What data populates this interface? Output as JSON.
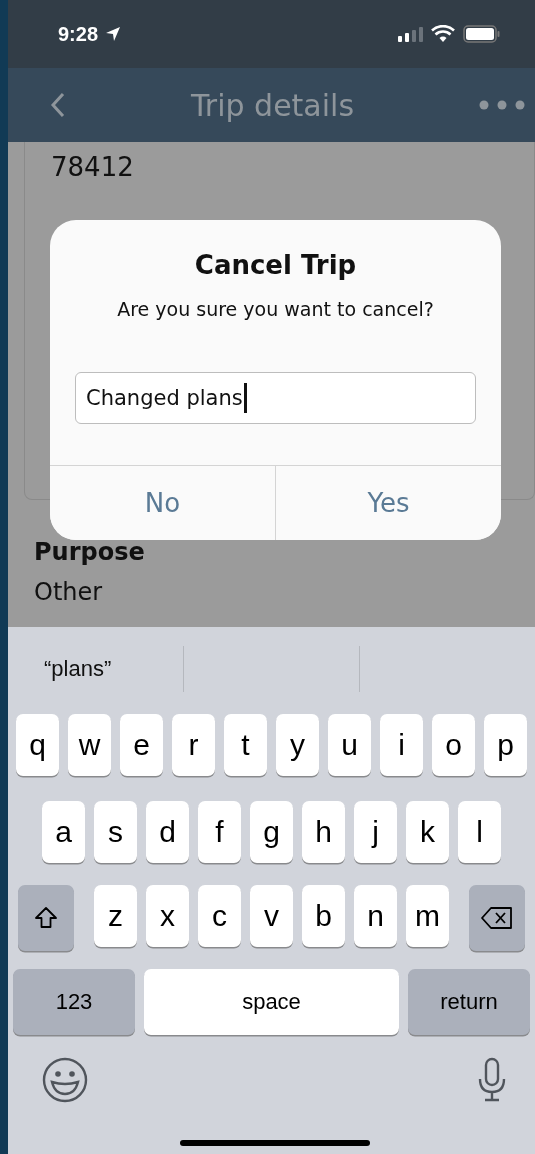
{
  "status_bar": {
    "time": "9:28"
  },
  "nav_bar": {
    "title": "Trip details"
  },
  "background": {
    "address_tail": "78412",
    "purpose_label": "Purpose",
    "purpose_value": "Other"
  },
  "dialog": {
    "title": "Cancel Trip",
    "message": "Are you sure you want to cancel?",
    "field": {
      "value": "Changed plans",
      "focused": true
    },
    "buttons": [
      "No",
      "Yes"
    ]
  },
  "keyboard": {
    "suggestions": [
      "“plans”"
    ],
    "rows": [
      [
        {
          "kind": "letter",
          "label": "q"
        },
        {
          "kind": "letter",
          "label": "w"
        },
        {
          "kind": "letter",
          "label": "e"
        },
        {
          "kind": "letter",
          "label": "r"
        },
        {
          "kind": "letter",
          "label": "t"
        },
        {
          "kind": "letter",
          "label": "y"
        },
        {
          "kind": "letter",
          "label": "u"
        },
        {
          "kind": "letter",
          "label": "i"
        },
        {
          "kind": "letter",
          "label": "o"
        },
        {
          "kind": "letter",
          "label": "p"
        }
      ],
      [
        {
          "kind": "letter",
          "label": "a"
        },
        {
          "kind": "letter",
          "label": "s"
        },
        {
          "kind": "letter",
          "label": "d"
        },
        {
          "kind": "letter",
          "label": "f"
        },
        {
          "kind": "letter",
          "label": "g"
        },
        {
          "kind": "letter",
          "label": "h"
        },
        {
          "kind": "letter",
          "label": "j"
        },
        {
          "kind": "letter",
          "label": "k"
        },
        {
          "kind": "letter",
          "label": "l"
        }
      ],
      [
        {
          "kind": "shift"
        },
        {
          "kind": "letter",
          "label": "z"
        },
        {
          "kind": "letter",
          "label": "x"
        },
        {
          "kind": "letter",
          "label": "c"
        },
        {
          "kind": "letter",
          "label": "v"
        },
        {
          "kind": "letter",
          "label": "b"
        },
        {
          "kind": "letter",
          "label": "n"
        },
        {
          "kind": "letter",
          "label": "m"
        },
        {
          "kind": "delete"
        }
      ]
    ],
    "bottom_bar": {
      "numbers_key": "123",
      "space_key": "space",
      "return_key": "return"
    }
  }
}
